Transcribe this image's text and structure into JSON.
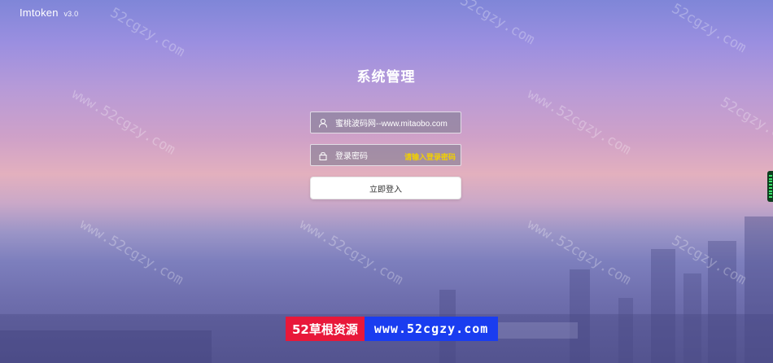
{
  "app": {
    "brand": "Imtoken",
    "version": "v3.0"
  },
  "login": {
    "title": "系统管理",
    "username_value": "蜜桃波码网--www.mitaobo.com",
    "password_placeholder": "登录密码",
    "password_hint": "请输入登录密码",
    "submit_label": "立即登入"
  },
  "icons": {
    "user": "user-icon",
    "lock": "lock-icon"
  },
  "watermark": {
    "text": "www.52cgzy.com",
    "short": "52cgzy.com"
  },
  "banner": {
    "left": "52草根资源",
    "right": "www.52cgzy.com"
  },
  "colors": {
    "hint": "#f2d000",
    "banner_left": "#e8183a",
    "banner_right": "#1a3df0"
  }
}
